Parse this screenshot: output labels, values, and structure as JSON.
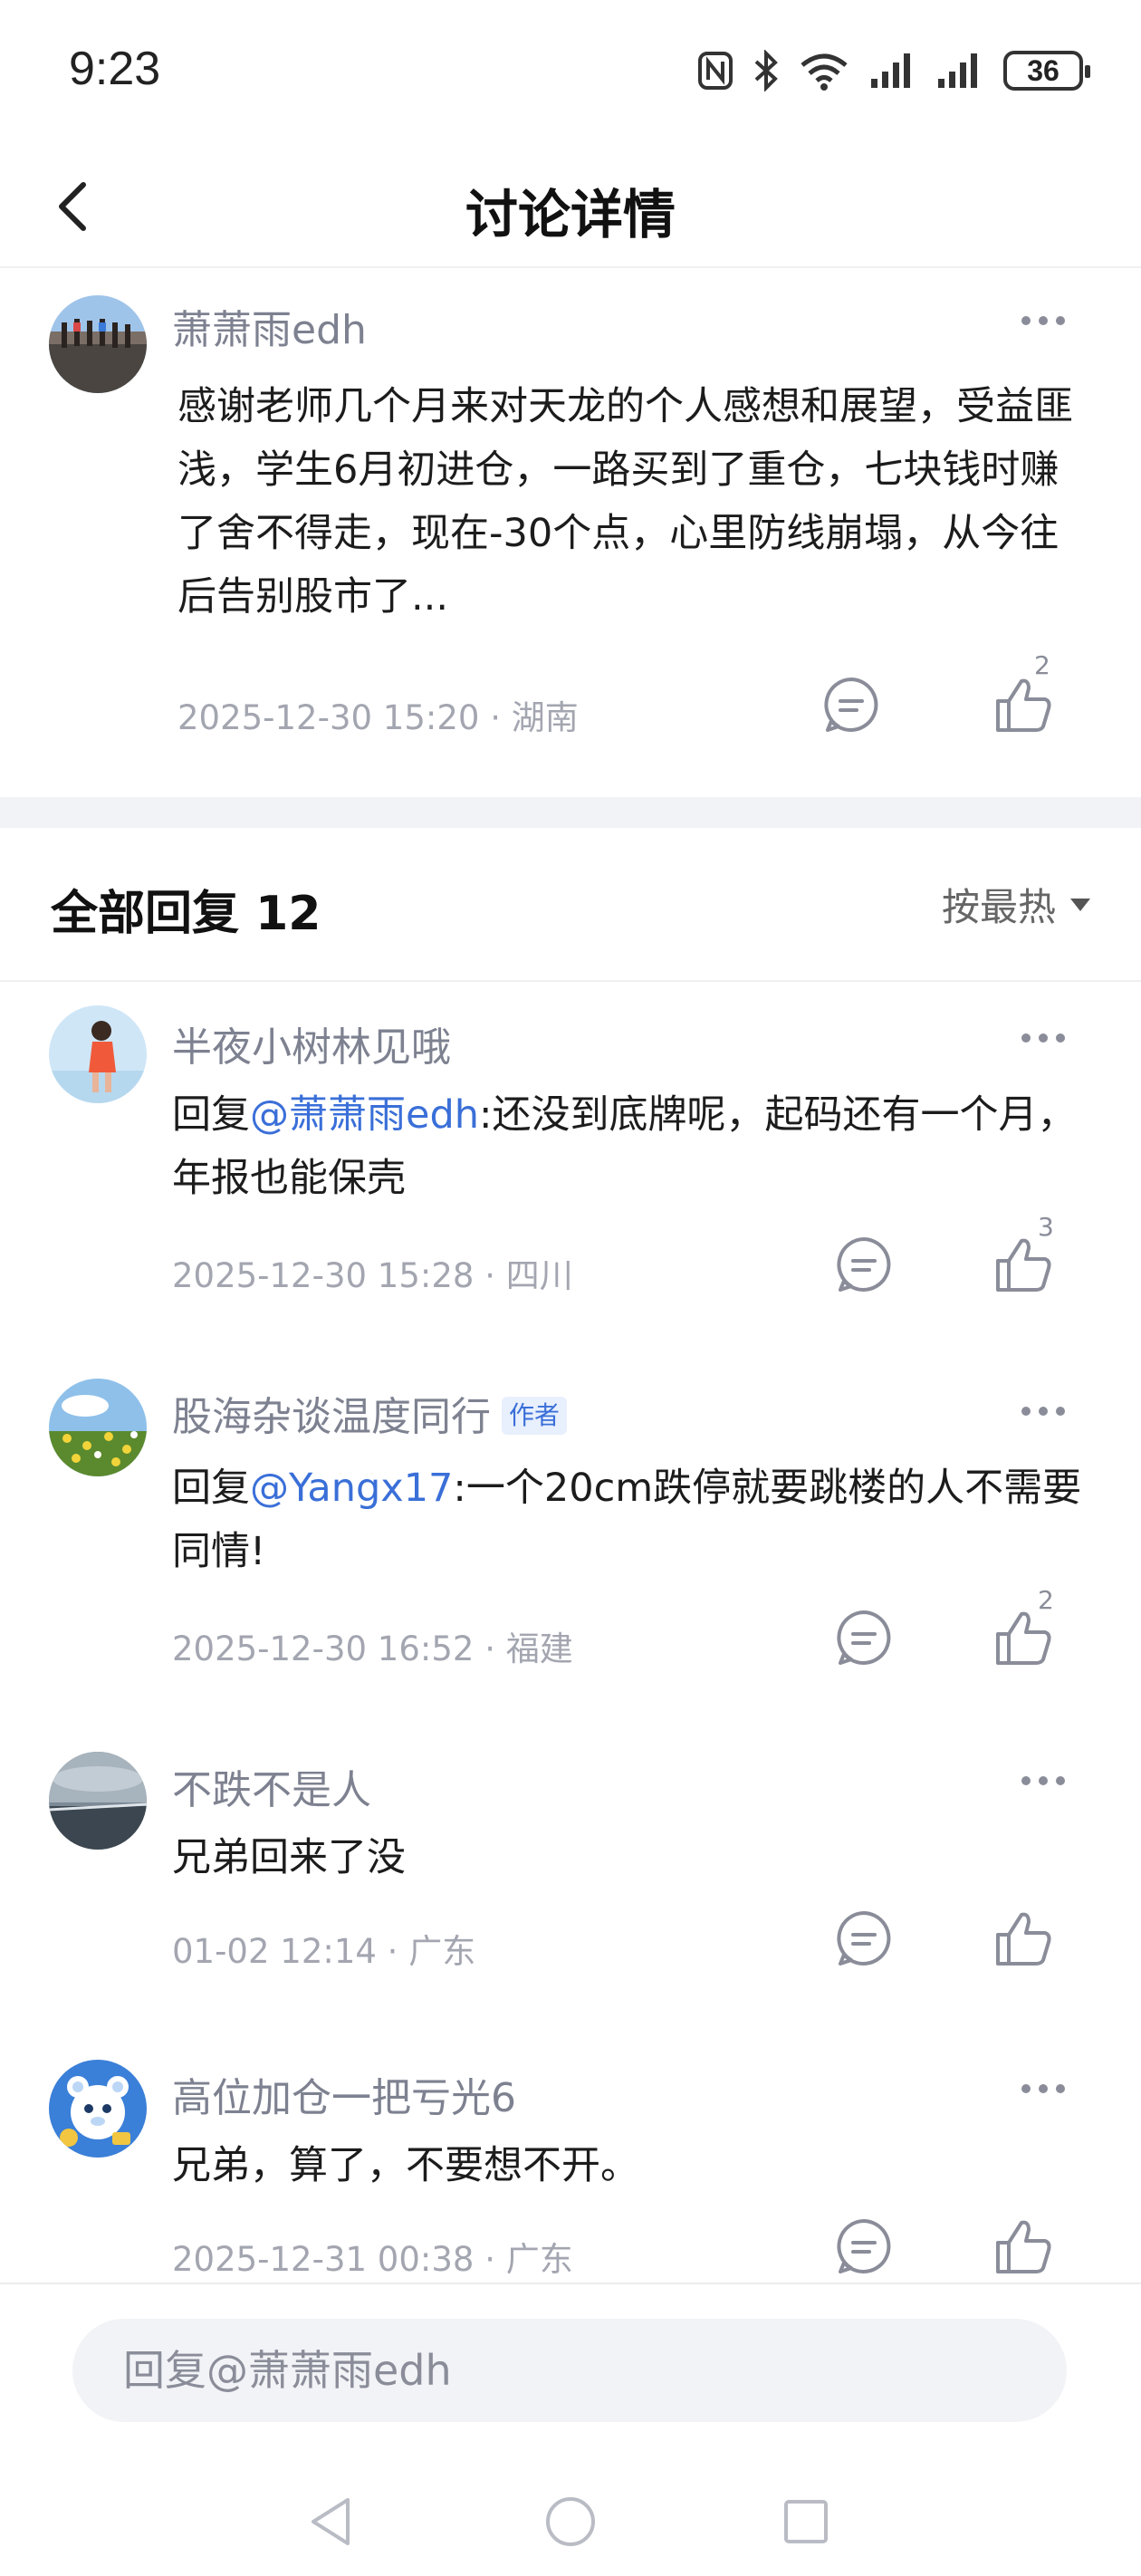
{
  "status_bar": {
    "time": "9:23",
    "battery": "36"
  },
  "header": {
    "title": "讨论详情"
  },
  "main_post": {
    "username": "萧萧雨edh",
    "content": "感谢老师几个月来对天龙的个人感想和展望，受益匪浅，学生6月初进仓，一路买到了重仓，七块钱时赚了舍不得走，现在-30个点，心里防线崩塌，从今往后告别股市了...",
    "datetime": "2025-12-30 15:20",
    "location": "湖南",
    "like_count": "2"
  },
  "replies_section": {
    "title": "全部回复 12",
    "sort_label": "按最热"
  },
  "replies": [
    {
      "username": "半夜小树林见哦",
      "prefix": "回复",
      "mention": "@萧萧雨edh",
      "text": ":还没到底牌呢，起码还有一个月，年报也能保壳",
      "datetime": "2025-12-30 15:28",
      "location": "四川",
      "like_count": "3"
    },
    {
      "username": "股海杂谈温度同行",
      "badge": "作者",
      "prefix": "回复",
      "mention": "@Yangx17",
      "text": ":一个20cm跌停就要跳楼的人不需要同情!",
      "datetime": "2025-12-30 16:52",
      "location": "福建",
      "like_count": "2"
    },
    {
      "username": "不跌不是人",
      "text": "兄弟回来了没",
      "datetime": "01-02 12:14",
      "location": "广东",
      "like_count": ""
    },
    {
      "username": "高位加仓一把亏光6",
      "text": "兄弟，算了，不要想不开。",
      "datetime": "2025-12-31 00:38",
      "location": "广东",
      "like_count": ""
    }
  ],
  "reply_input": {
    "placeholder": "回复@萧萧雨edh"
  },
  "meta_separator": "·"
}
